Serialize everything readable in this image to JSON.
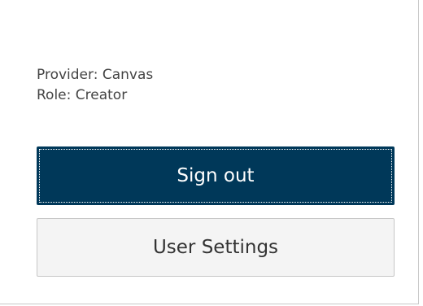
{
  "account": {
    "provider_line": "Provider: Canvas",
    "role_line": "Role: Creator"
  },
  "actions": {
    "sign_out_label": "Sign out",
    "user_settings_label": "User Settings"
  },
  "colors": {
    "primary_button_bg": "#003859",
    "secondary_button_bg": "#f4f4f4"
  }
}
